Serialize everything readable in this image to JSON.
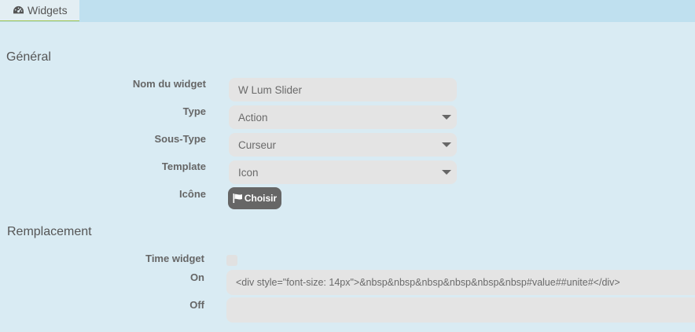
{
  "tab": {
    "label": "Widgets"
  },
  "general": {
    "title": "Général",
    "name_label": "Nom du widget",
    "name_value": "W Lum Slider",
    "type_label": "Type",
    "type_value": "Action",
    "subtype_label": "Sous-Type",
    "subtype_value": "Curseur",
    "template_label": "Template",
    "template_value": "Icon",
    "icon_label": "Icône",
    "choose_label": "Choisir"
  },
  "replacement": {
    "title": "Remplacement",
    "time_widget_label": "Time widget",
    "on_label": "On",
    "on_value": "<div style=\"font-size: 14px\">&nbsp&nbsp&nbsp&nbsp&nbsp&nbsp#value##unite#</div>",
    "off_label": "Off",
    "off_value": ""
  }
}
